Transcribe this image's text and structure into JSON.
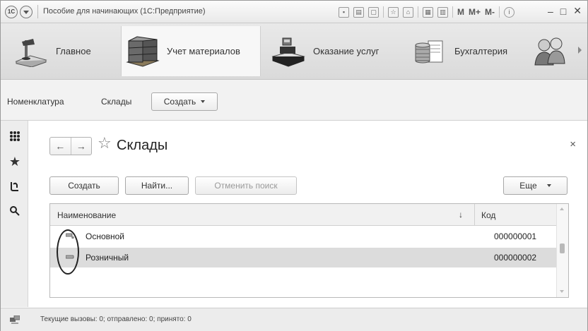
{
  "window": {
    "title": "Пособие для начинающих (1С:Предприятие)",
    "logo_text": "1С",
    "toolbar_text": [
      "M",
      "M+",
      "M-"
    ]
  },
  "sections": [
    {
      "label": "Главное",
      "icon": "desk-lamp-icon",
      "active": false
    },
    {
      "label": "Учет материалов",
      "icon": "materials-pallet-icon",
      "active": true
    },
    {
      "label": "Оказание услуг",
      "icon": "cash-register-icon",
      "active": false
    },
    {
      "label": "Бухгалтерия",
      "icon": "coins-documents-icon",
      "active": false
    },
    {
      "label": "",
      "icon": "people-icon",
      "active": false
    }
  ],
  "navbar": {
    "links": [
      "Номенклатура",
      "Склады"
    ],
    "create_label": "Создать"
  },
  "form": {
    "title": "Склады",
    "close_glyph": "×",
    "buttons": {
      "create": "Создать",
      "find": "Найти...",
      "cancel_search": "Отменить поиск",
      "more": "Еще"
    },
    "table": {
      "columns": [
        "Наименование",
        "Код"
      ],
      "sort_glyph": "↓",
      "rows": [
        {
          "name": "Основной",
          "code": "000000001",
          "selected": false
        },
        {
          "name": "Розничный",
          "code": "000000002",
          "selected": true
        }
      ]
    }
  },
  "status": {
    "text": "Текущие вызовы: 0; отправлено: 0; принято: 0"
  }
}
